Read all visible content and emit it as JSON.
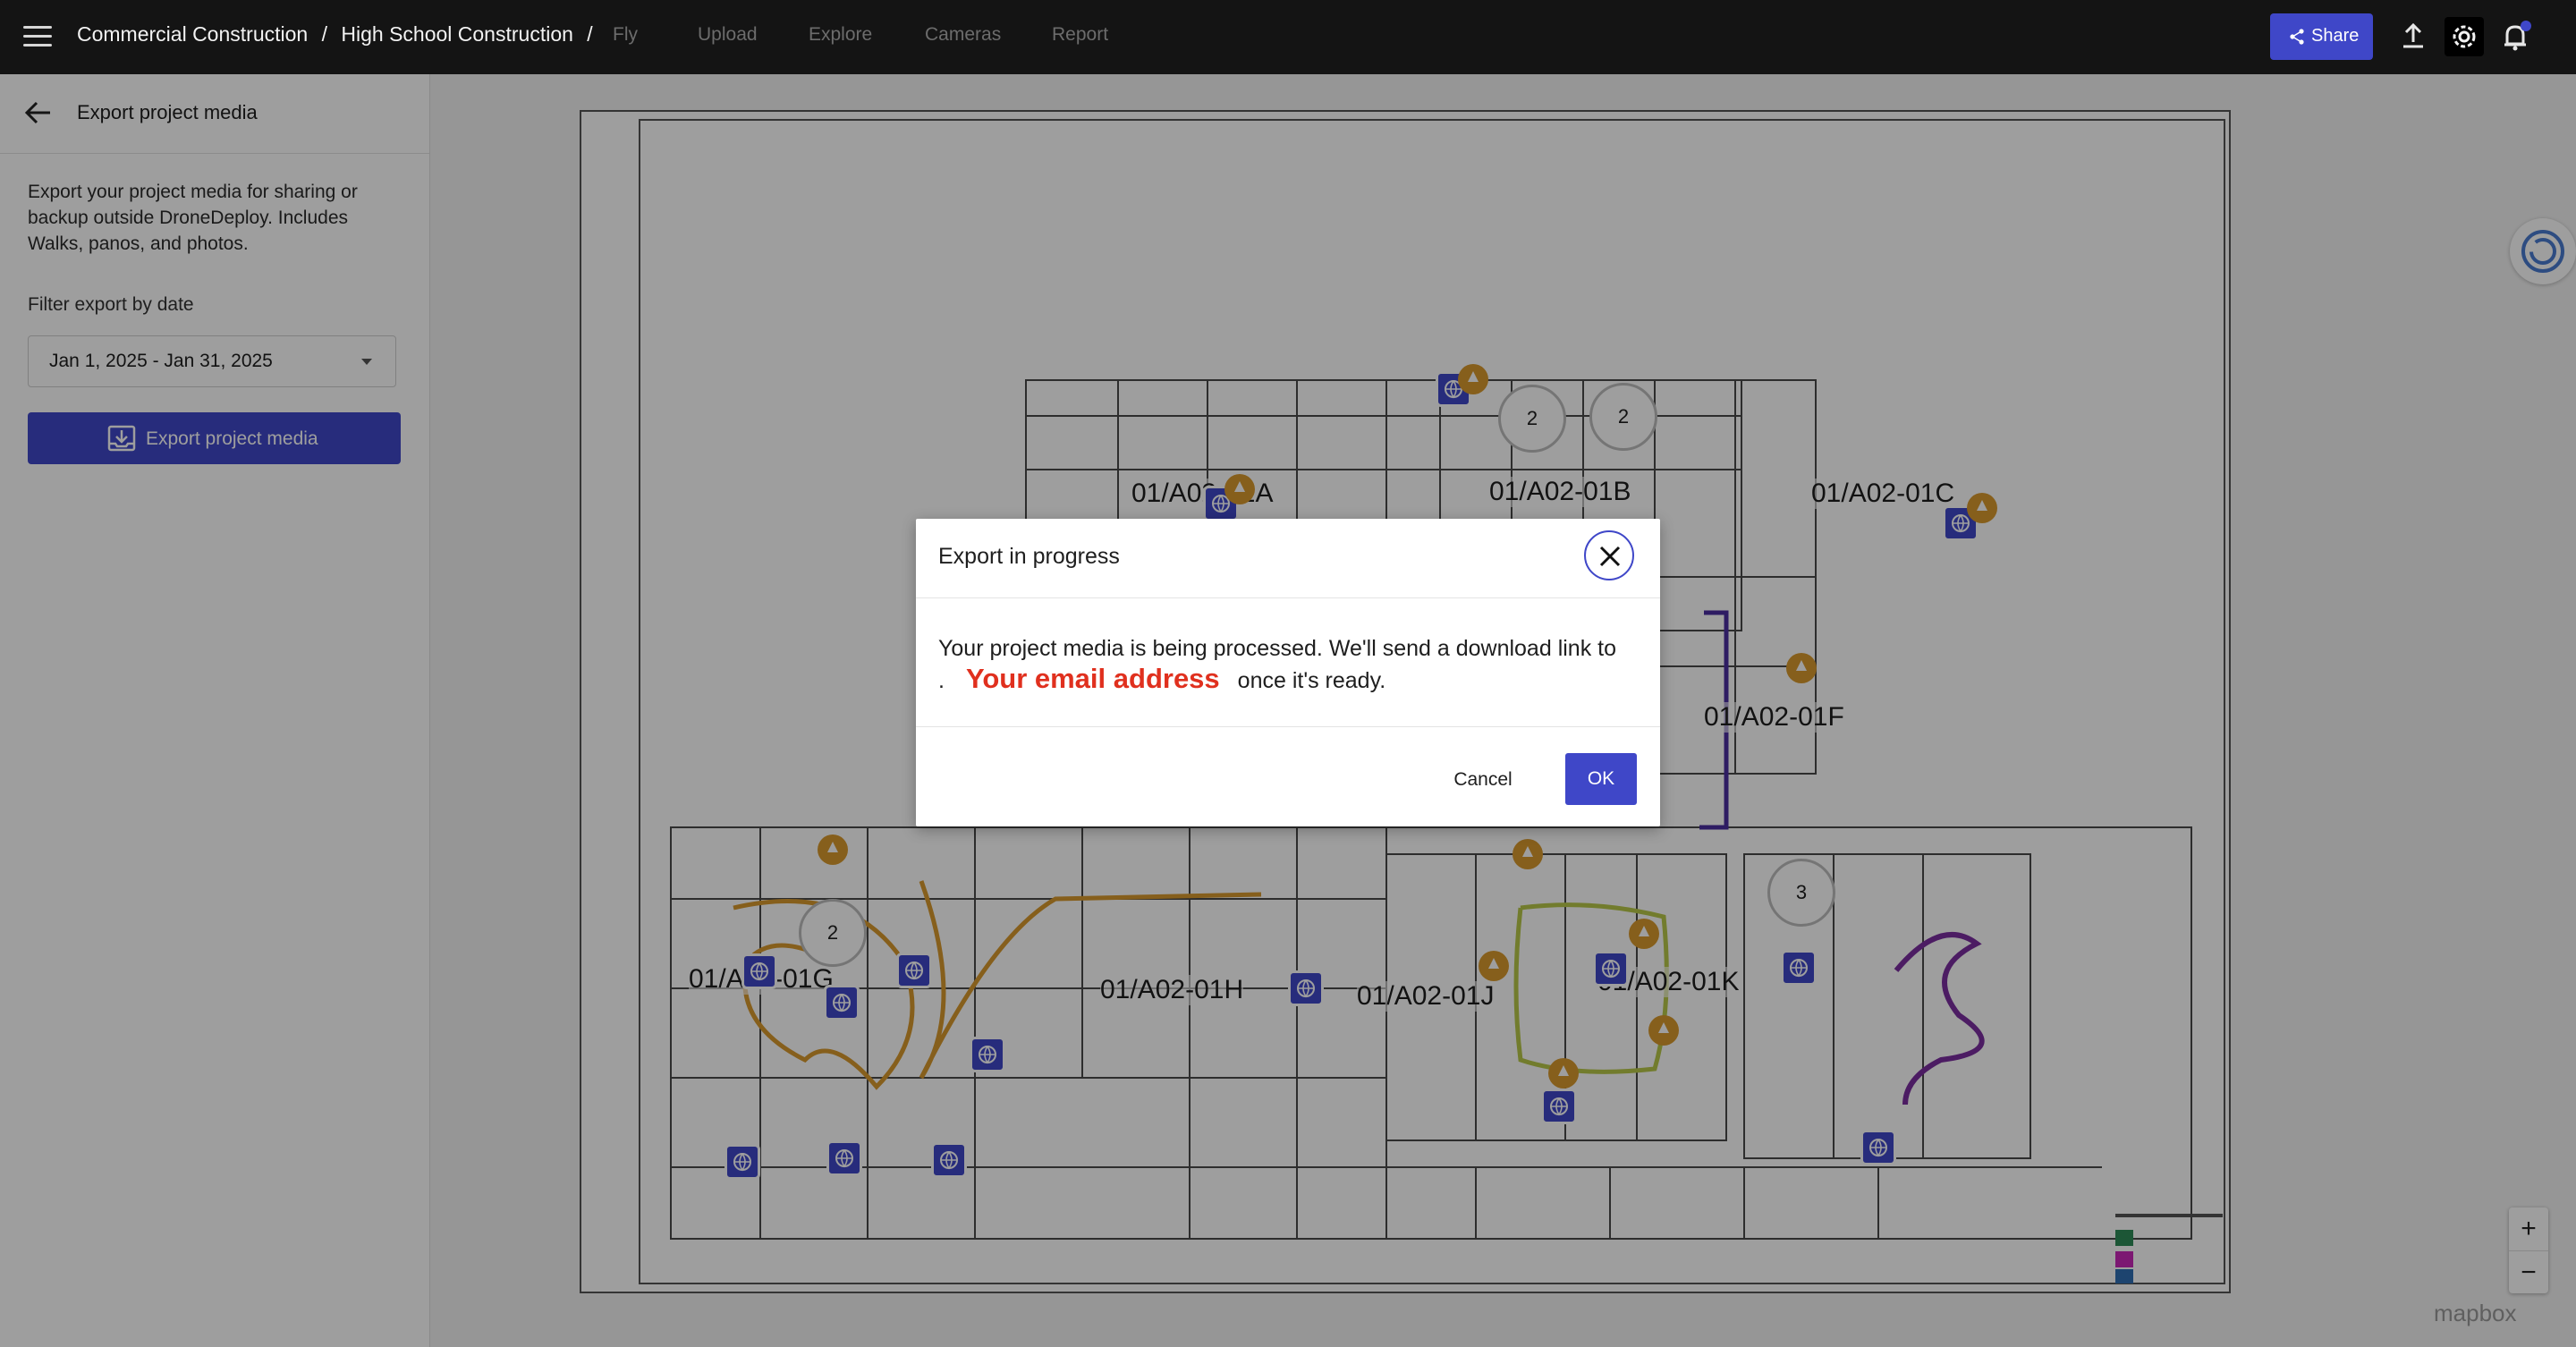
{
  "topbar": {
    "breadcrumb": [
      "Commercial Construction",
      "/",
      "High School Construction",
      "/"
    ],
    "nav": [
      "Fly",
      "Upload",
      "Explore",
      "Cameras",
      "Report"
    ],
    "share_label": "Share"
  },
  "panel": {
    "title": "Export project media",
    "description": "Export your project media for sharing or backup outside DroneDeploy. Includes Walks, panos, and photos.",
    "filter_label": "Filter export by date",
    "date_range": "Jan 1, 2025 - Jan 31, 2025",
    "export_button": "Export project media"
  },
  "map": {
    "zone_labels": [
      "01/A02-01A",
      "01/A02-01B",
      "01/A02-01C",
      "01/A02-01F",
      "01/A02-01G",
      "01/A02-01H",
      "01/A02-01J",
      "01/A02-01K"
    ],
    "clusters": [
      "2",
      "2",
      "2",
      "3"
    ],
    "zoom_in": "+",
    "zoom_out": "−",
    "attribution": "mapbox"
  },
  "modal": {
    "title": "Export in progress",
    "body_prefix": "Your project media is being processed. We'll send a download link to .",
    "email": "Your email address",
    "body_suffix": "once it's ready.",
    "cancel": "Cancel",
    "ok": "OK"
  },
  "colors": {
    "accent": "#3f47c8",
    "topbar": "#141414",
    "email_highlight": "#e0301e",
    "walk_orange": "#d99a2e",
    "walk_purple": "#7b2ea0",
    "walk_green": "#b8c94a"
  }
}
